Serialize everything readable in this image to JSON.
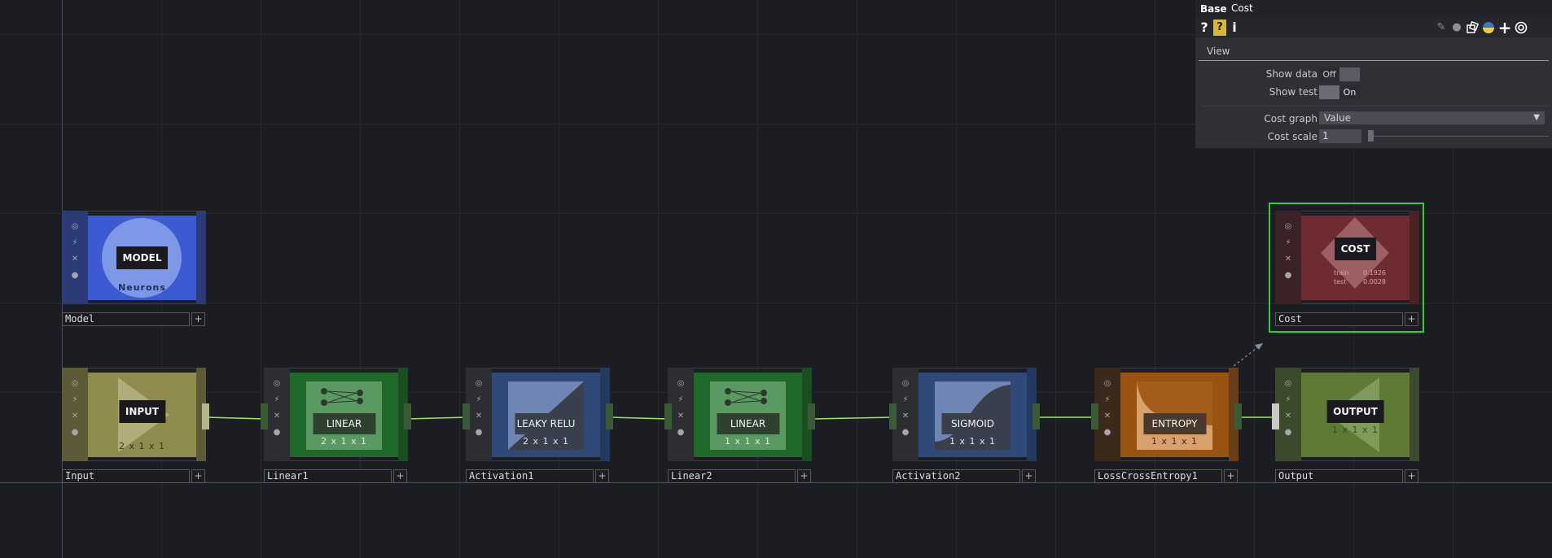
{
  "network": {
    "nodes": [
      {
        "id": "model",
        "name": "Model",
        "label": "MODEL",
        "sublabel": "Neurons",
        "dims": "",
        "type": "model"
      },
      {
        "id": "input",
        "name": "Input",
        "label": "INPUT",
        "dims": "2 x 1 x 1",
        "type": "input"
      },
      {
        "id": "linear1",
        "name": "Linear1",
        "label": "LINEAR",
        "dims": "2 x 1 x 1",
        "type": "linear"
      },
      {
        "id": "activation1",
        "name": "Activation1",
        "label": "LEAKY RELU",
        "dims": "2 x 1 x 1",
        "type": "activation"
      },
      {
        "id": "linear2",
        "name": "Linear2",
        "label": "LINEAR",
        "dims": "1 x 1 x 1",
        "type": "linear"
      },
      {
        "id": "activation2",
        "name": "Activation2",
        "label": "SIGMOID",
        "dims": "1 x 1 x 1",
        "type": "activation"
      },
      {
        "id": "loss",
        "name": "LossCrossEntropy1",
        "label": "ENTROPY",
        "dims": "1 x 1 x 1",
        "type": "loss"
      },
      {
        "id": "output",
        "name": "Output",
        "label": "OUTPUT",
        "dims": "1 x 1 x 1",
        "type": "output"
      },
      {
        "id": "cost",
        "name": "Cost",
        "label": "COST",
        "type": "cost",
        "selected": true,
        "train_label": "train",
        "train_value": "0.1926",
        "test_label": "test",
        "test_value": "0.0028"
      }
    ],
    "node_flag_icons": [
      "viewer-flag-icon",
      "bypass-flag-icon",
      "lock-flag-icon",
      "cook-flag-icon"
    ],
    "add_glyph": "+",
    "colors": {
      "model": "#3c5bd2",
      "input": "#8f8a4e",
      "linear": "#2f8a3c",
      "activation": "#3f5f99",
      "loss": "#b8641a",
      "output": "#5e7a35",
      "cost": "#6e2b30",
      "selection": "#2ed12e",
      "wire": "#9fe65e"
    }
  },
  "panel": {
    "op_type": "Base",
    "op_name": "Cost",
    "tab": "View",
    "toolbar_icons": [
      "help-icon",
      "operator-help-icon",
      "info-icon",
      "edit-icon",
      "comment-icon",
      "clone-icon",
      "python-icon",
      "add-parameter-icon",
      "target-icon"
    ],
    "help_glyph": "?",
    "info_glyph": "i",
    "add_glyph": "+",
    "params": {
      "show_data": {
        "label": "Show data",
        "off": "Off",
        "on": "On",
        "value": "Off"
      },
      "show_test": {
        "label": "Show test",
        "off": "Off",
        "on": "On",
        "value": "On"
      },
      "cost_graph": {
        "label": "Cost graph",
        "value": "Value"
      },
      "cost_scale": {
        "label": "Cost scale",
        "value": "1"
      }
    }
  }
}
